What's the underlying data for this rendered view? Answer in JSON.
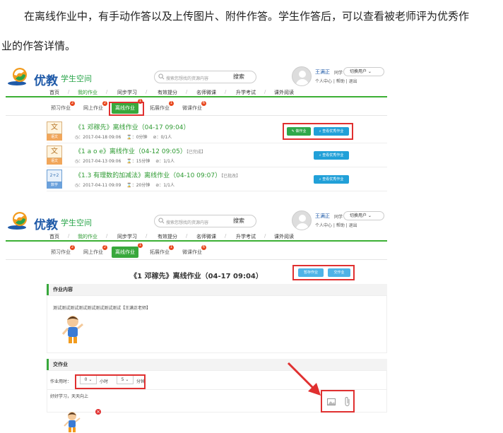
{
  "intro": {
    "line1": "在离线作业中，有手动作答以及上传图片、附件作答。学生作答后，可以查看被老师评为优秀作",
    "line2": "业的作答详情。"
  },
  "header": {
    "brand": "优教",
    "sub": "学生空间",
    "search_placeholder": "搜索您想找的资源内容",
    "search_btn": "搜索",
    "user_name": "王满正",
    "user_role": "同学",
    "switch_user": "切换用户",
    "user_links": "个人中心 | 帮助 | 退出"
  },
  "nav": {
    "items": [
      "首页",
      "我的作业",
      "同步学习",
      "有效提分",
      "名师微课",
      "升学考试",
      "课外阅读"
    ],
    "active": "我的作业"
  },
  "subtabs": [
    {
      "label": "预习作业",
      "badge": "2"
    },
    {
      "label": "网上作业",
      "badge": "2"
    },
    {
      "label": "离线作业",
      "badge": "1"
    },
    {
      "label": "拓展作业",
      "badge": "1"
    },
    {
      "label": "微课作业",
      "badge": "6"
    }
  ],
  "subtabs2": {
    "b0": "2",
    "b1": "2",
    "b2": "1",
    "b3": "1",
    "b4": "6"
  },
  "assignments": [
    {
      "subject": "语文",
      "subject_icon": "文",
      "title": "《1 邓稼先》离线作业（04-17 09:04）",
      "tag": "",
      "date": "2017-04-18 09:06",
      "duration": "0分钟",
      "submitted": "0/1人",
      "btn_answer": "做作业",
      "btn_excellent": "查看优秀作业"
    },
    {
      "subject": "语文",
      "subject_icon": "文",
      "title": "《1 a o e》离线作业（04-12 09:05）",
      "tag": "【已完成】",
      "date": "2017-04-13 09:06",
      "duration": "15分钟",
      "submitted": "1/1人",
      "btn_excellent": "查看优秀作业"
    },
    {
      "subject": "数学",
      "subject_icon": "2+2",
      "title": "《1.3 有理数的加减法》离线作业（04-10 09:07）",
      "tag": "【已批改】",
      "date": "2017-04-11 09:09",
      "duration": "20分钟",
      "submitted": "1/1人",
      "btn_excellent": "查看优秀作业"
    }
  ],
  "detail": {
    "title": "《1 邓稼先》离线作业（04-17 09:04）",
    "btn_save": "暂存作业",
    "btn_submit": "交作业",
    "content_head": "作业内容",
    "content_text": "测试测试测试测试测试测试测试测试【王满正老师】",
    "submit_head": "交作业",
    "time_label": "作业用时：",
    "hours_value": "0",
    "hours_unit": "小时",
    "minutes_value": "5",
    "minutes_unit": "分钟",
    "answer_text": "好好学习，天天向上",
    "delete_mark": "×"
  },
  "colors": {
    "accent_green": "#38a83c",
    "highlight_red": "#e03030",
    "button_blue": "#21a0d8"
  }
}
